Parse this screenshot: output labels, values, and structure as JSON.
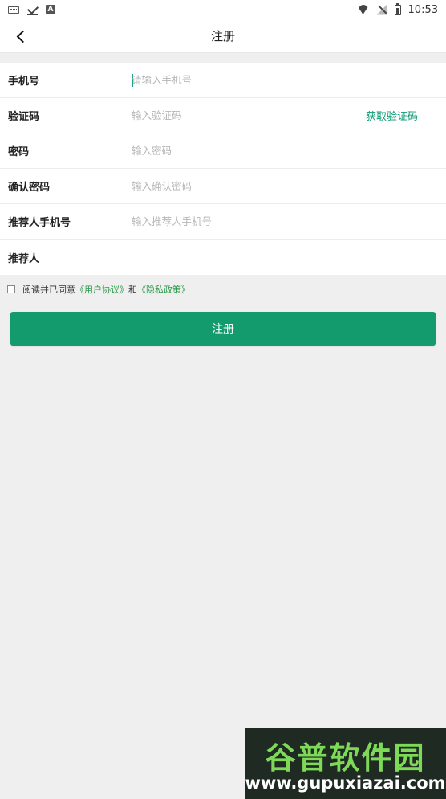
{
  "status_bar": {
    "time": "10:53",
    "icons": [
      "keyboard-icon",
      "check-icon",
      "a-notification-icon",
      "wifi-icon",
      "no-signal-icon",
      "battery-icon"
    ]
  },
  "navbar": {
    "title": "注册",
    "back_icon": "chevron-left-icon"
  },
  "form": {
    "rows": [
      {
        "label": "手机号",
        "placeholder": "请输入手机号",
        "value": ""
      },
      {
        "label": "验证码",
        "placeholder": "输入验证码",
        "value": "",
        "action": "获取验证码"
      },
      {
        "label": "密码",
        "placeholder": "输入密码",
        "value": ""
      },
      {
        "label": "确认密码",
        "placeholder": "输入确认密码",
        "value": ""
      },
      {
        "label": "推荐人手机号",
        "placeholder": "输入推荐人手机号",
        "value": ""
      },
      {
        "label": "推荐人",
        "placeholder": "",
        "value": ""
      }
    ]
  },
  "agreement": {
    "checked": false,
    "prefix": "阅读并已同意",
    "user_agreement": "《用户协议》",
    "and": "和",
    "privacy_policy": "《隐私政策》"
  },
  "submit": {
    "label": "注册"
  },
  "watermark": {
    "title": "谷普软件园",
    "url": "www.gupuxiazai.com"
  },
  "colors": {
    "accent": "#139b6e",
    "link": "#2e9a4a",
    "background": "#efefef"
  }
}
